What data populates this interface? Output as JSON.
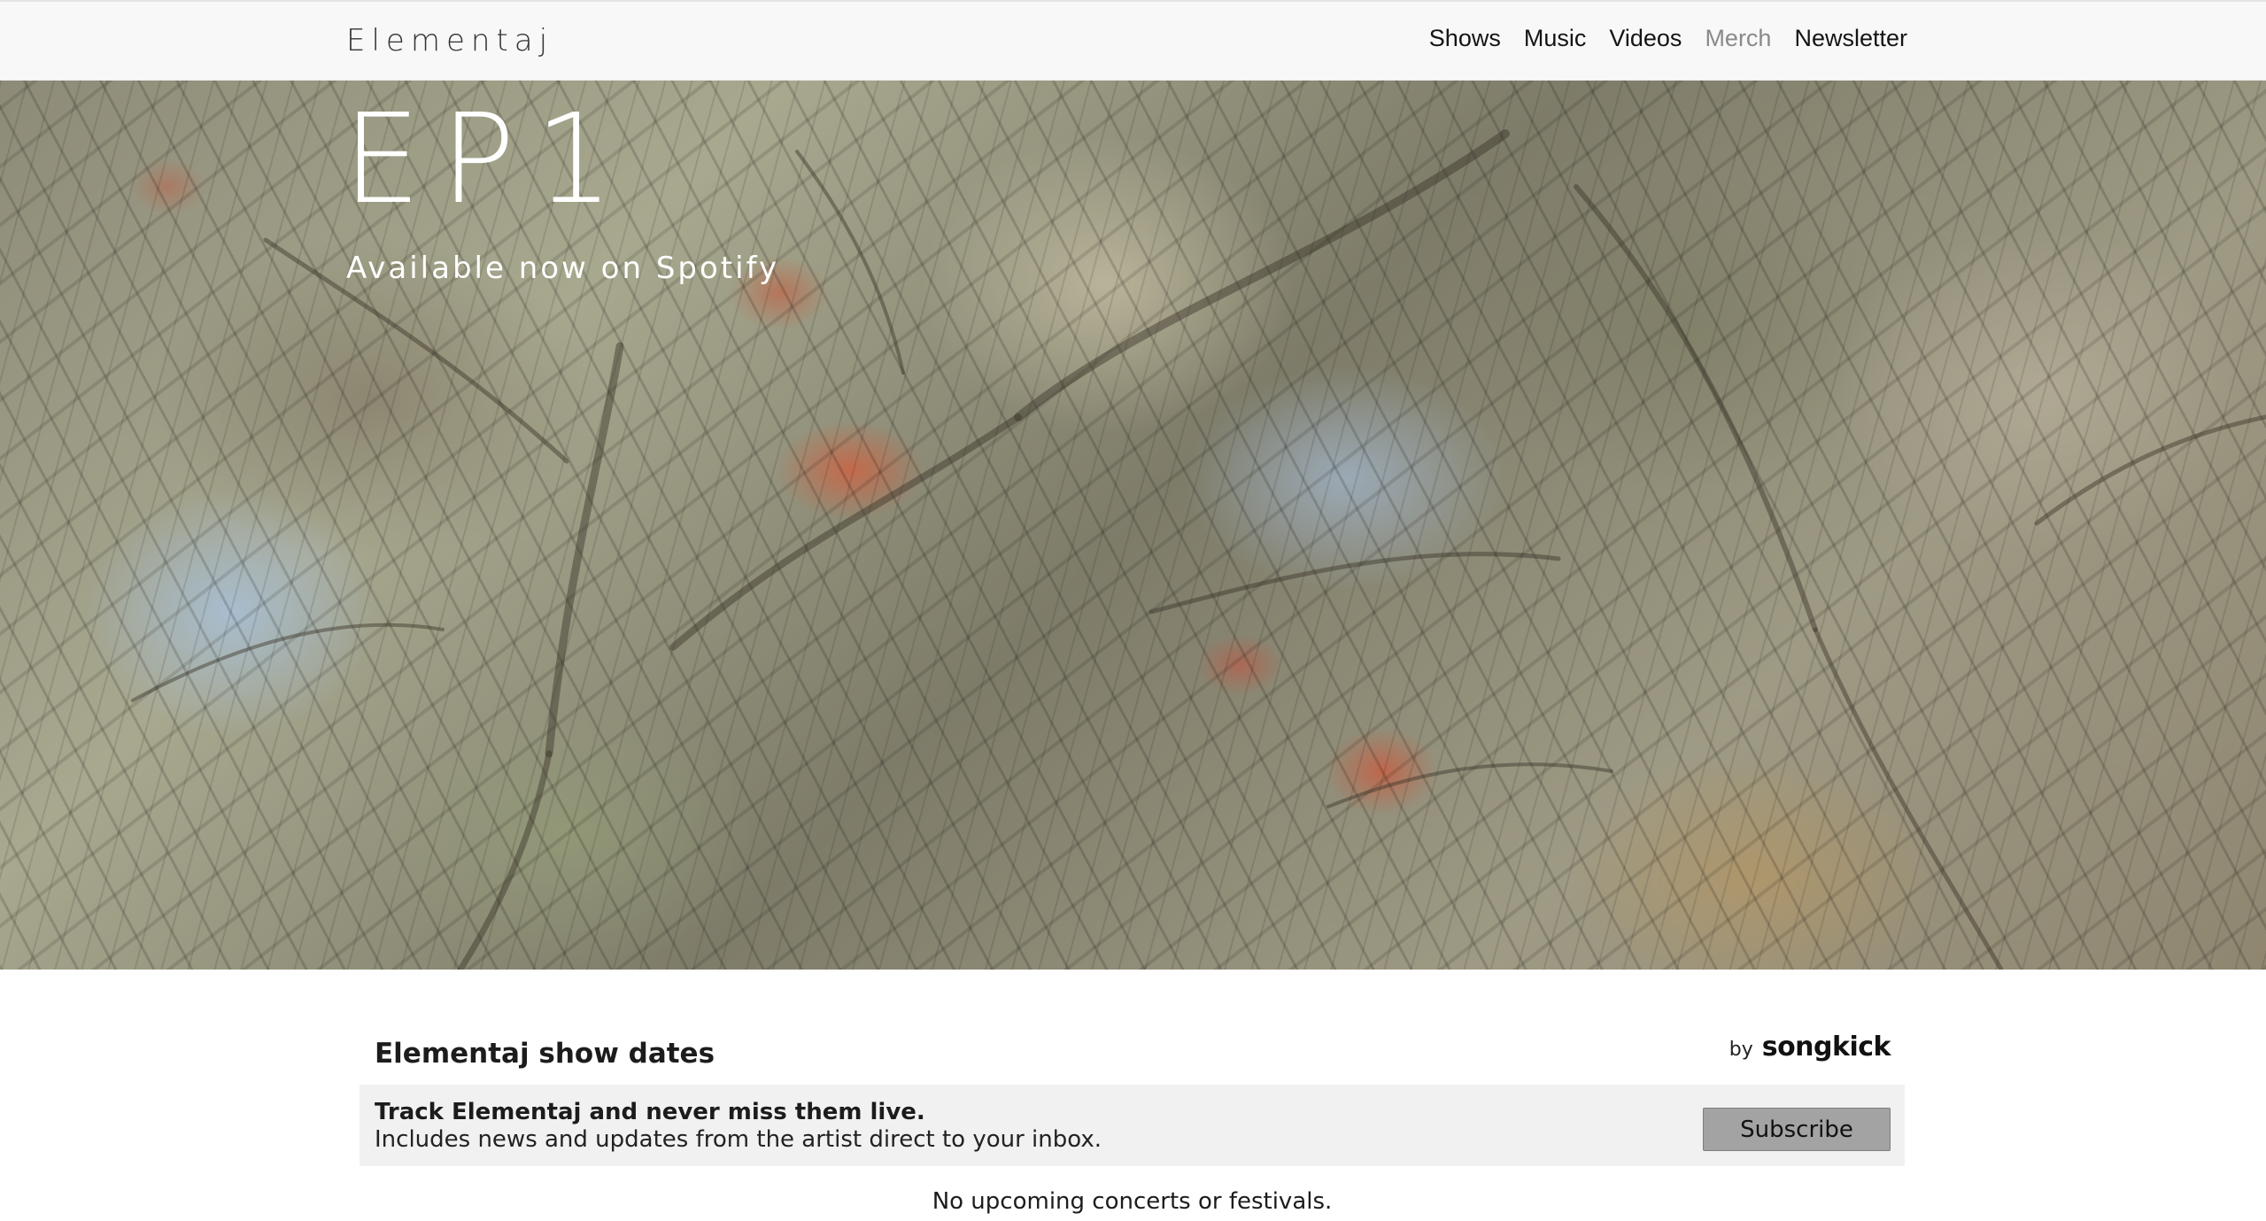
{
  "brand": {
    "name": "Elementaj"
  },
  "nav": {
    "items": [
      {
        "label": "Shows",
        "muted": false
      },
      {
        "label": "Music",
        "muted": false
      },
      {
        "label": "Videos",
        "muted": false
      },
      {
        "label": "Merch",
        "muted": true
      },
      {
        "label": "Newsletter",
        "muted": false
      }
    ]
  },
  "hero": {
    "title": "EP1",
    "subtitle": "Available now on Spotify"
  },
  "widget": {
    "title": "Elementaj show dates",
    "by": "by",
    "provider": "songkick",
    "track_heading": "Track Elementaj and never miss them live.",
    "track_description": "Includes news and updates from the artist direct to your inbox.",
    "subscribe_label": "Subscribe",
    "empty_message": "No upcoming concerts or festivals."
  },
  "colors": {
    "navbar_bg": "#f8f8f9",
    "muted_link": "#8a8a8a",
    "track_box_bg": "#f1f1f1",
    "subscribe_bg": "#a3a3a3"
  }
}
